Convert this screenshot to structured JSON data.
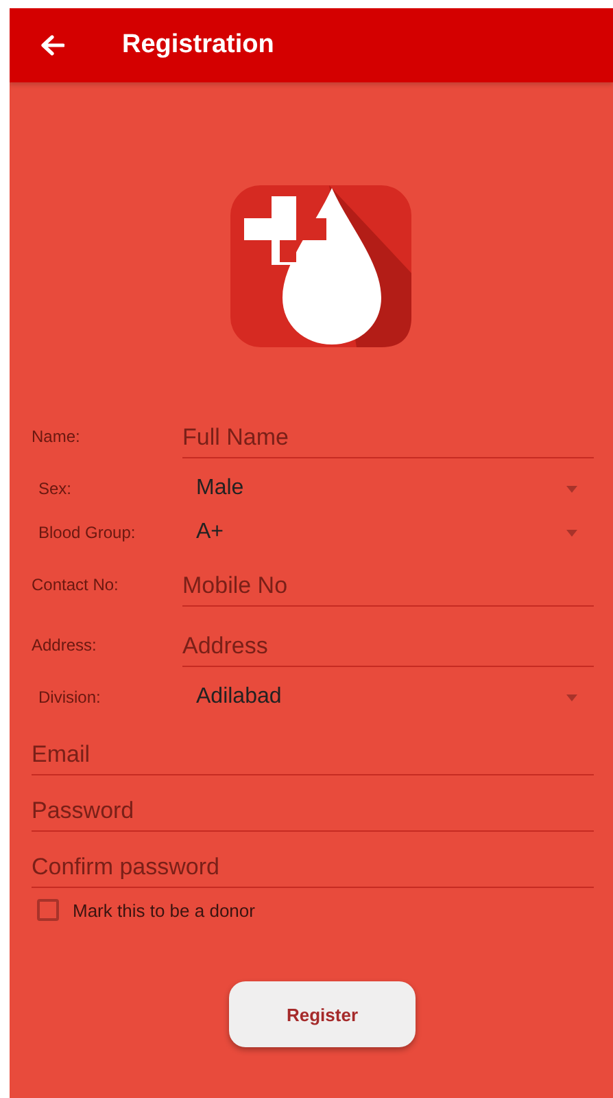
{
  "app_bar": {
    "title": "Registration"
  },
  "rows": [
    {
      "kind": "text",
      "label": "Name:",
      "placeholder": "Full Name"
    },
    {
      "kind": "select",
      "label": "Sex:",
      "value": "Male"
    },
    {
      "kind": "select",
      "label": "Blood Group:",
      "value": "A+"
    },
    {
      "kind": "text",
      "label": "Contact No:",
      "placeholder": "Mobile No"
    },
    {
      "kind": "text",
      "label": "Address:",
      "placeholder": "Address"
    },
    {
      "kind": "select",
      "label": "Division:",
      "value": "Adilabad"
    }
  ],
  "fields": [
    {
      "placeholder": "Email"
    },
    {
      "placeholder": "Password"
    },
    {
      "placeholder": "Confirm password"
    }
  ],
  "donor_checkbox": {
    "label": "Mark this to be a donor",
    "checked": false
  },
  "register_button": {
    "label": "Register"
  }
}
